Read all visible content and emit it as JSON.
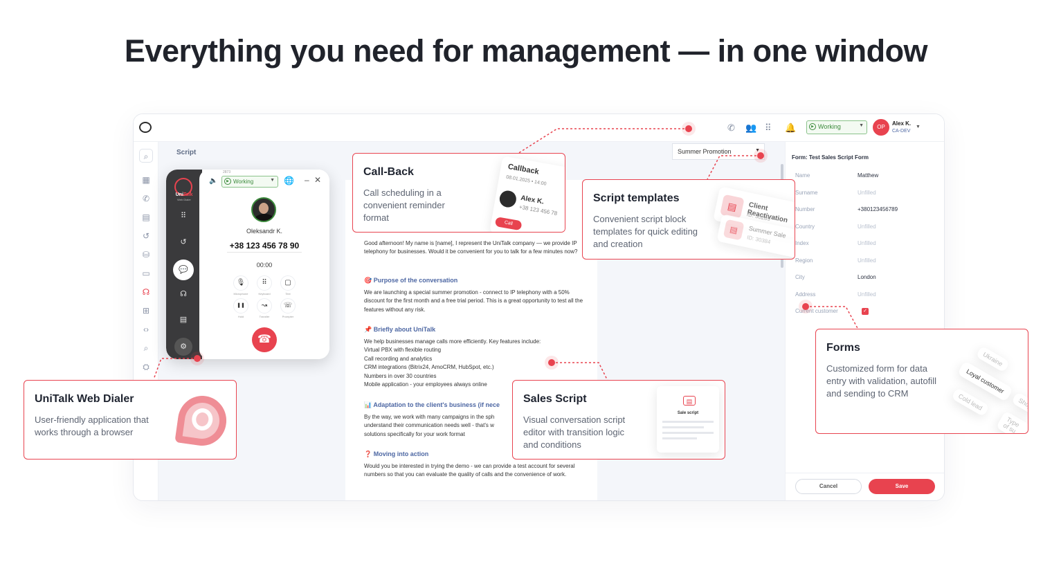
{
  "headline": "Everything you need for management — in one window",
  "colors": {
    "accent": "#e8434f",
    "working": "#3b8a3b",
    "link": "#4d67a3"
  },
  "topbar": {
    "status": "Working",
    "user_initials": "OP",
    "user_name": "Alex K.",
    "user_role": "CA-DEV",
    "icons": [
      "phone-icon",
      "users-icon",
      "grid-icon",
      "bell-icon"
    ]
  },
  "leftnav": [
    "search-icon",
    "dashboard-icon",
    "phone-icon",
    "chat-icon",
    "callback-icon",
    "basket-icon",
    "message-icon",
    "operator-icon",
    "add-box-icon",
    "code-icon",
    "search-icon",
    "robot-icon"
  ],
  "script": {
    "tab": "Script",
    "template_selected": "Summer Promotion",
    "intro": "Good afternoon! My name is [name], I represent the UniTalk company — we provide IP telephony for businesses. Would it be convenient for you to talk for a few minutes now?",
    "sections": [
      {
        "emoji": "🎯",
        "title": "Purpose of the conversation",
        "body": "We are launching a special summer promotion - connect to IP telephony with a 50% discount for the first month and a free trial period. This is a great opportunity to test all the features without any risk."
      },
      {
        "emoji": "📌",
        "title": "Briefly about UniTalk",
        "body": "We help businesses manage calls more efficiently. Key features include:\nVirtual PBX with flexible routing\nCall recording and analytics\nCRM integrations (Bitrix24, AmoCRM, HubSpot, etc.)\nNumbers in over 30 countries\nMobile application - your employees always online"
      },
      {
        "emoji": "📊",
        "title": "Adaptation to the client's business  (if nece",
        "body": "By the way, we work with many campaigns in the sph\nunderstand their communication needs well - that's w\nsolutions specifically for your work format"
      },
      {
        "emoji": "❓",
        "title": "Moving into action",
        "body": "Would you be interested in trying the demo - we can provide a test account for several numbers so that you can evaluate the quality of calls and the convenience of work."
      }
    ]
  },
  "form": {
    "title": "Form: Test Sales Script Form",
    "fields": [
      {
        "label": "Name",
        "value": "Matthew",
        "filled": true
      },
      {
        "label": "Surname",
        "value": "Unfilled",
        "filled": false
      },
      {
        "label": "Number",
        "value": "+380123456789",
        "filled": true
      },
      {
        "label": "Country",
        "value": "Unfilled",
        "filled": false
      },
      {
        "label": "Index",
        "value": "Unfilled",
        "filled": false
      },
      {
        "label": "Region",
        "value": "Unfilled",
        "filled": false
      },
      {
        "label": "City",
        "value": "London",
        "filled": true
      },
      {
        "label": "Address",
        "value": "Unfilled",
        "filled": false
      }
    ],
    "current_customer_label": "Current customer",
    "current_customer_checked": true,
    "cancel": "Cancel",
    "save": "Save"
  },
  "dialer": {
    "brand_line1": "Uni",
    "brand_line2": "Talk",
    "brand_sub": "Web Dialer",
    "ext": "2873",
    "status": "Working",
    "contact_name": "Oleksandr K.",
    "contact_number": "+38 123 456 78 90",
    "timer": "00:00",
    "actions": [
      {
        "icon": "microphone-icon",
        "glyph": "🎙",
        "label": "Microphone"
      },
      {
        "icon": "keypad-icon",
        "glyph": "⠿",
        "label": "Keyboard"
      },
      {
        "icon": "text-icon",
        "glyph": "▢",
        "label": "Text"
      },
      {
        "icon": "hold-icon",
        "glyph": "❚❚",
        "label": "Hold"
      },
      {
        "icon": "transfer-icon",
        "glyph": "↝",
        "label": "Transfer"
      },
      {
        "icon": "prompter-icon",
        "glyph": "☏",
        "label": "Prompter"
      }
    ]
  },
  "callouts": {
    "callback": {
      "title": "Call-Back",
      "desc": "Call scheduling in a convenient reminder format",
      "card_label": "Callback",
      "card_date": "08.01.2025 • 14:00",
      "card_name": "Alex K.",
      "card_number": "+38 123 456 78",
      "card_button": "Call"
    },
    "templates": {
      "title": "Script templates",
      "desc": "Convenient script block templates for quick editing and creation",
      "chip1_name": "Client Reactivation",
      "chip1_id": "ID: 30289",
      "chip2_name": "Summer Sale",
      "chip2_id": "ID: 30384"
    },
    "dialer": {
      "title": "UniTalk Web Dialer",
      "desc": "User-friendly application that works through a browser"
    },
    "sales": {
      "title": "Sales Script",
      "desc": "Visual conversation script editor with transition logic and conditions",
      "thumb_label": "Sale script"
    },
    "forms": {
      "title": "Forms",
      "desc": "Customized form for data entry with validation, autofill and sending to CRM",
      "tags": [
        "Ukraine",
        "Loyal customer",
        "Cold lead",
        "Type of su",
        "Shop"
      ]
    }
  }
}
